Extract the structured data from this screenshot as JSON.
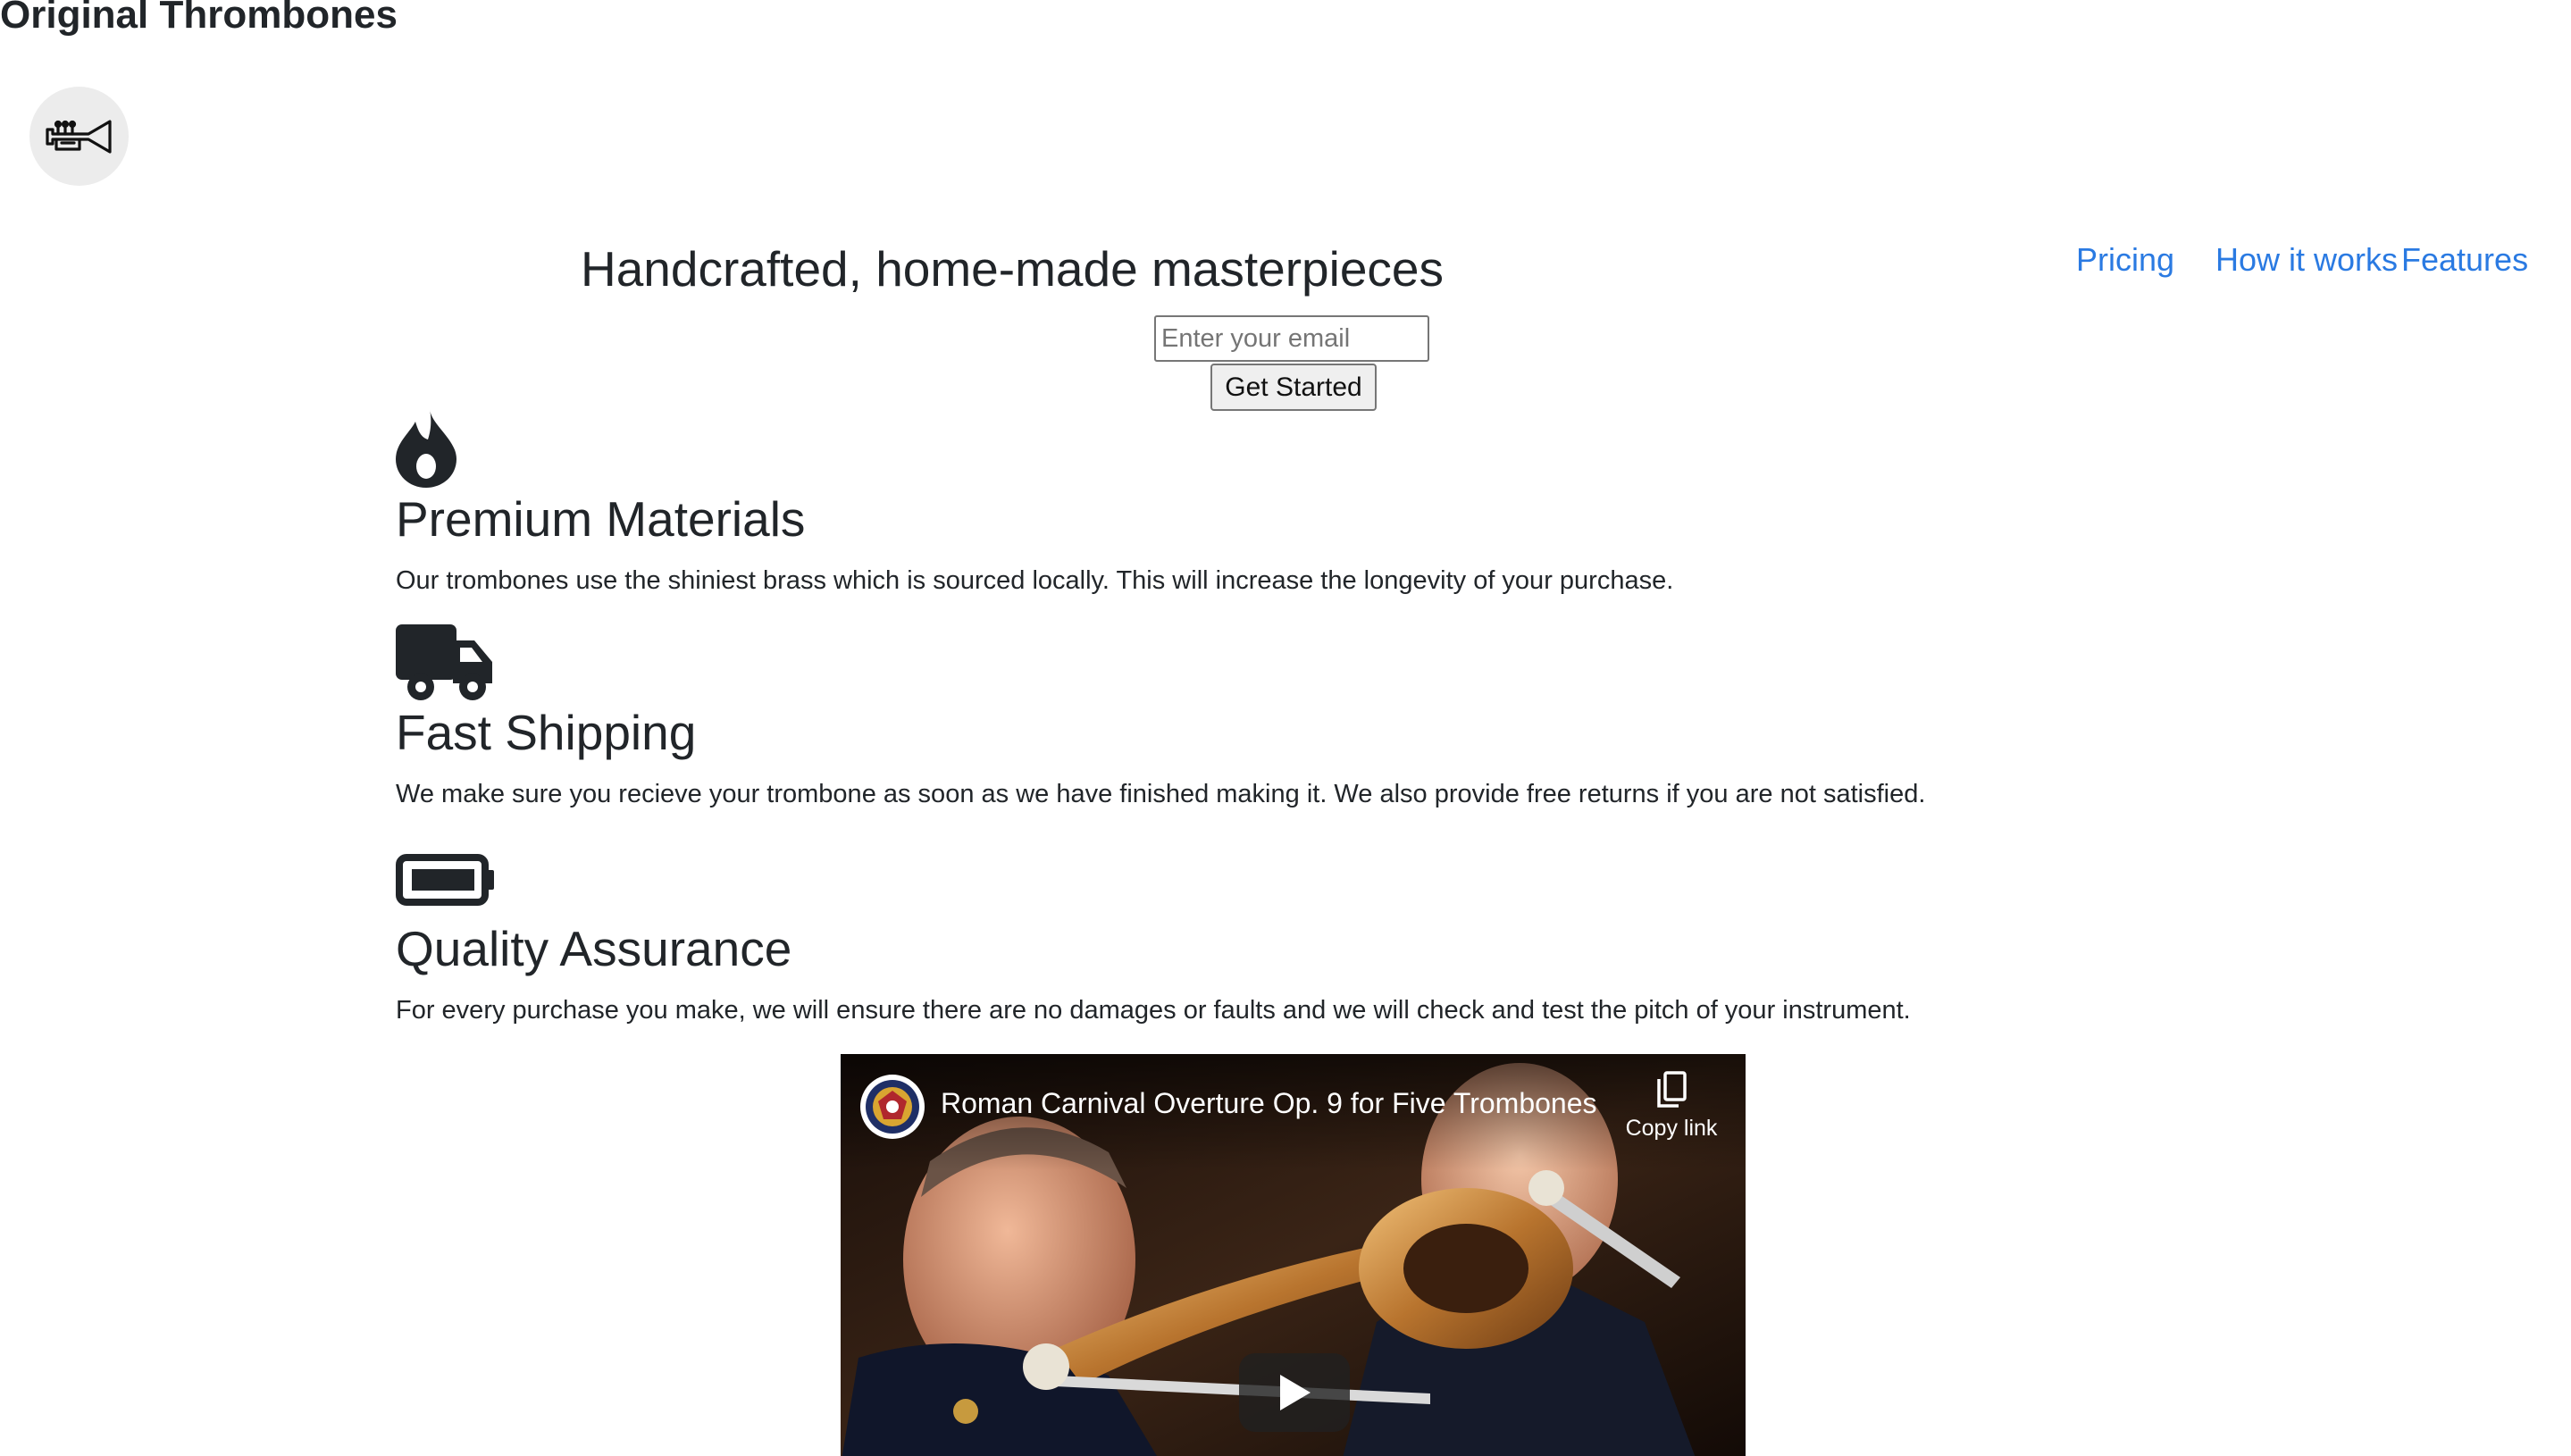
{
  "site": {
    "title": "Original Thrombones",
    "logo_icon": "trumpet-icon"
  },
  "nav": {
    "items": [
      {
        "label": "Pricing"
      },
      {
        "label": "How it works"
      },
      {
        "label": "Features"
      }
    ],
    "link_color": "#2a7ae2"
  },
  "hero": {
    "title": "Handcrafted, home-made masterpieces",
    "email_placeholder": "Enter your email",
    "email_value": "",
    "button_label": "Get Started"
  },
  "features": [
    {
      "icon": "fire-icon",
      "heading": "Premium Materials",
      "description": "Our trombones use the shiniest brass which is sourced locally. This will increase the longevity of your purchase."
    },
    {
      "icon": "truck-icon",
      "heading": "Fast Shipping",
      "description": "We make sure you recieve your trombone as soon as we have finished making it. We also provide free returns if you are not satisfied."
    },
    {
      "icon": "battery-full-icon",
      "heading": "Quality Assurance",
      "description": "For every purchase you make, we will ensure there are no damages or faults and we will check and test the pitch of your instrument."
    }
  ],
  "video": {
    "title": "Roman Carnival Overture Op. 9 for Five Trombones",
    "copy_link_label": "Copy link",
    "copy_icon": "copy-icon",
    "play_icon": "play-icon",
    "channel_icon": "channel-avatar-icon"
  },
  "colors": {
    "text": "#212529",
    "link": "#2a7ae2",
    "logo_background": "#ececec"
  }
}
